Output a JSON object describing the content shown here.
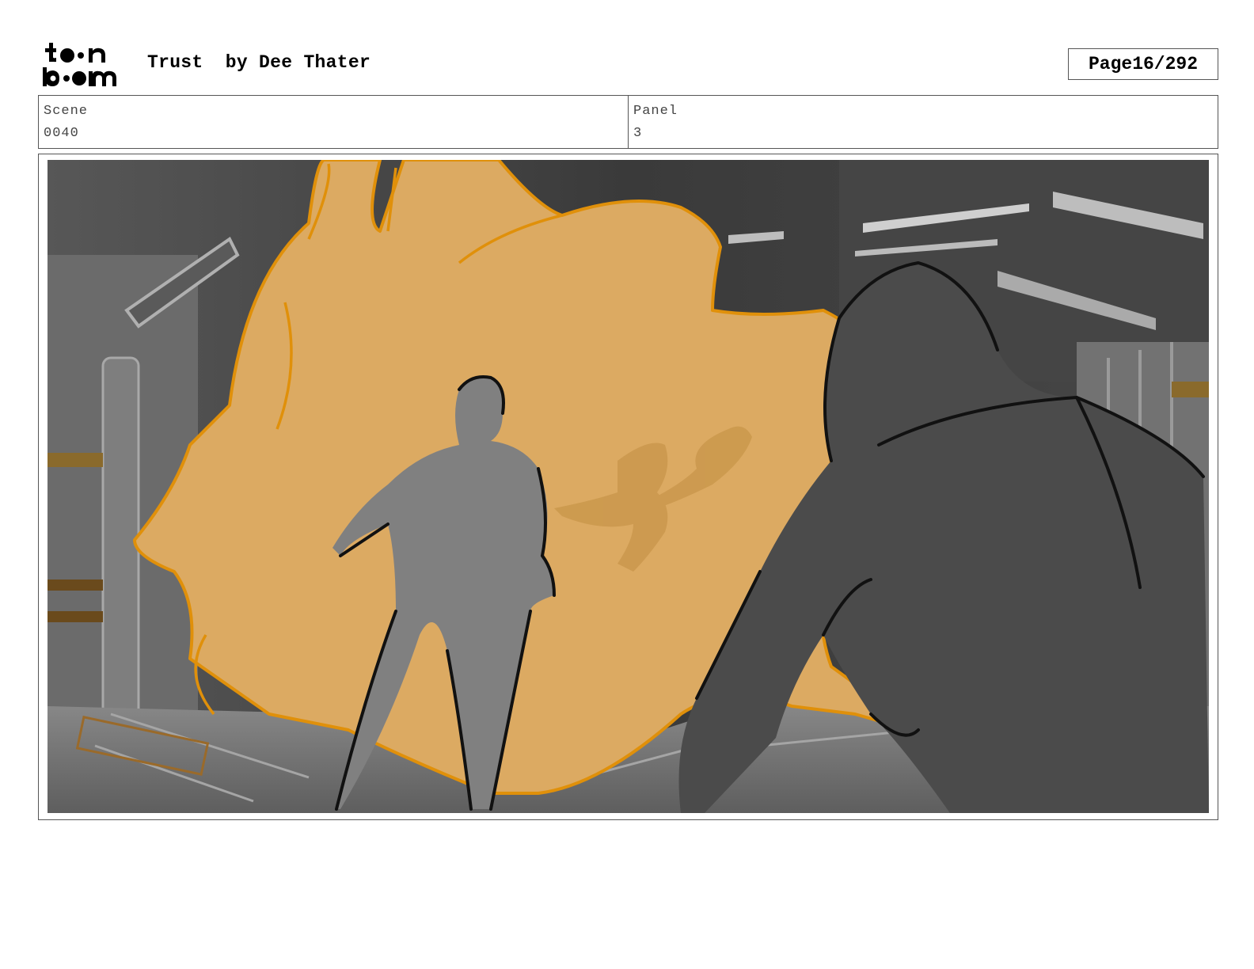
{
  "header": {
    "logo_text": "toonboom",
    "title": "Trust",
    "author": "by Dee Thater",
    "page_label": "Page",
    "page_number": "16/292"
  },
  "info": {
    "scene_label": "Scene",
    "scene_value": "0040",
    "panel_label": "Panel",
    "panel_value": "3"
  },
  "panel_image": {
    "description_icon": "storyboard-sketch",
    "colors": {
      "background_dark": "#3c3c3c",
      "wall_gray": "#7a7a7a",
      "orange_fill": "#dcaa62",
      "orange_line": "#e0900a",
      "figure_light": "#808080",
      "figure_dark": "#4a4a4a"
    }
  }
}
